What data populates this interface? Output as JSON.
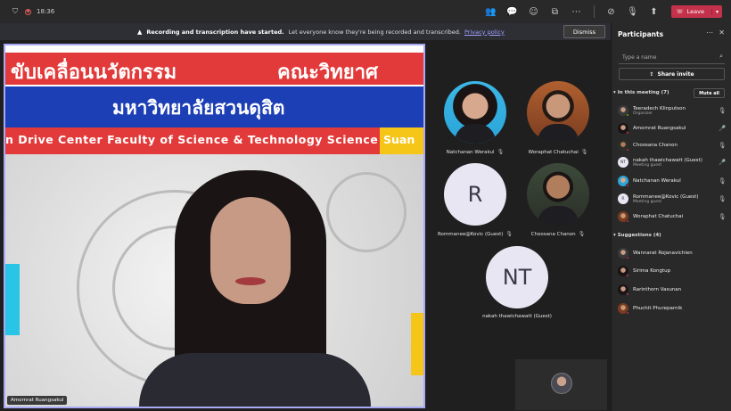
{
  "topbar": {
    "time": "18:36",
    "leave_label": "Leave"
  },
  "banner": {
    "bold": "Recording and transcription have started.",
    "text": "Let everyone know they're being recorded and transcribed.",
    "link": "Privacy policy",
    "dismiss_label": "Dismiss"
  },
  "slide": {
    "thai_title_left": "ขับเคลื่อนนวัตกรรม",
    "thai_title_right": "คณะวิทยาศ",
    "university": "มหาวิทยาลัยสวนดุสิต",
    "english_line": "n Drive Center    Faculty of Science & Technology Science",
    "english_suan": "Suan"
  },
  "main_speaker": {
    "name": "Amornrat Ruangsakul"
  },
  "tiles": [
    {
      "name": "Natchanan Werakul",
      "initials": ""
    },
    {
      "name": "Woraphat Chatuchai",
      "initials": ""
    },
    {
      "name": "Rommanee@Kovic (Guest)",
      "initials": "R"
    },
    {
      "name": "Choosana Chanon",
      "initials": ""
    },
    {
      "name": "nakah thawichawatt (Guest)",
      "initials": "NT"
    }
  ],
  "panel": {
    "title": "Participants",
    "search_placeholder": "Type a name",
    "share_label": "Share invite",
    "in_meeting_label": "In this meeting (7)",
    "mute_all_label": "Mute all",
    "suggestions_label": "Suggestions (4)",
    "participants": [
      {
        "name": "Teeradech Klinputson",
        "sub": "Organizer",
        "initials": ""
      },
      {
        "name": "Amornrat Ruangsakul",
        "sub": "",
        "initials": ""
      },
      {
        "name": "Choosana Chanon",
        "sub": "",
        "initials": ""
      },
      {
        "name": "nakah thawichawatt (Guest)",
        "sub": "Meeting guest",
        "initials": "NT"
      },
      {
        "name": "Natchanan Werakul",
        "sub": "",
        "initials": ""
      },
      {
        "name": "Rommanee@Kovic (Guest)",
        "sub": "Meeting guest",
        "initials": "R"
      },
      {
        "name": "Woraphat Chatuchai",
        "sub": "",
        "initials": ""
      }
    ],
    "suggestions": [
      {
        "name": "Wannarat Rojanavichien"
      },
      {
        "name": "Sirima Kongtup"
      },
      {
        "name": "Rarinthorn Vasunan"
      },
      {
        "name": "Phuchit Phureparnik"
      }
    ]
  },
  "colors": {
    "accent": "#a9aaf5",
    "leave": "#c4314b",
    "link": "#9ea4ff",
    "slide_red": "#e23a3a",
    "slide_blue": "#1d3fb5"
  }
}
